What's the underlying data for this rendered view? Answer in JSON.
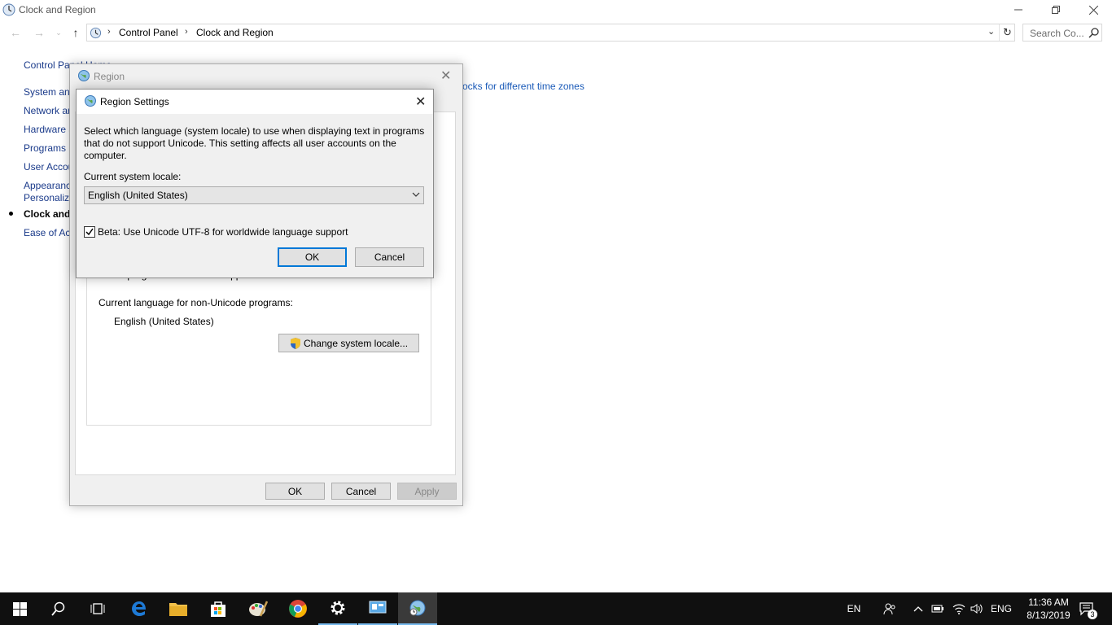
{
  "window": {
    "title": "Clock and Region",
    "search_placeholder": "Search Co...",
    "breadcrumb": [
      "Control Panel",
      "Clock and Region"
    ]
  },
  "sidebar": {
    "items": [
      {
        "label": "Control Panel Home"
      },
      {
        "label": "System and"
      },
      {
        "label": "Network ar"
      },
      {
        "label": "Hardware a"
      },
      {
        "label": "Programs"
      },
      {
        "label": "User Accou"
      },
      {
        "label": "Appearanc"
      },
      {
        "label": "Personaliza"
      },
      {
        "label": "Clock and"
      },
      {
        "label": "Ease of Acc"
      }
    ]
  },
  "background_link": "ocks for different time zones",
  "region_dialog": {
    "title": "Region",
    "partial_text": "text in programs that do not support Unicode.",
    "lang_label": "Current language for non-Unicode programs:",
    "lang_value": "English (United States)",
    "change_locale_button": "Change system locale...",
    "ok": "OK",
    "cancel": "Cancel",
    "apply": "Apply"
  },
  "region_settings": {
    "title": "Region Settings",
    "description": "Select which language (system locale) to use when displaying text in programs that do not support Unicode. This setting affects all user accounts on the computer.",
    "locale_label": "Current system locale:",
    "locale_value": "English (United States)",
    "beta_checkbox_label": "Beta: Use Unicode UTF-8 for worldwide language support",
    "beta_checked": true,
    "ok": "OK",
    "cancel": "Cancel"
  },
  "taskbar": {
    "apps": [
      "start-icon",
      "search-icon",
      "task-view-icon",
      "edge-icon",
      "file-explorer-icon",
      "store-icon",
      "paint-icon",
      "chrome-icon",
      "settings-icon",
      "control-panel-icon",
      "region-icon"
    ],
    "input_indicator": "EN",
    "language": "ENG",
    "time": "11:36 AM",
    "date": "8/13/2019",
    "notification_count": "3"
  }
}
